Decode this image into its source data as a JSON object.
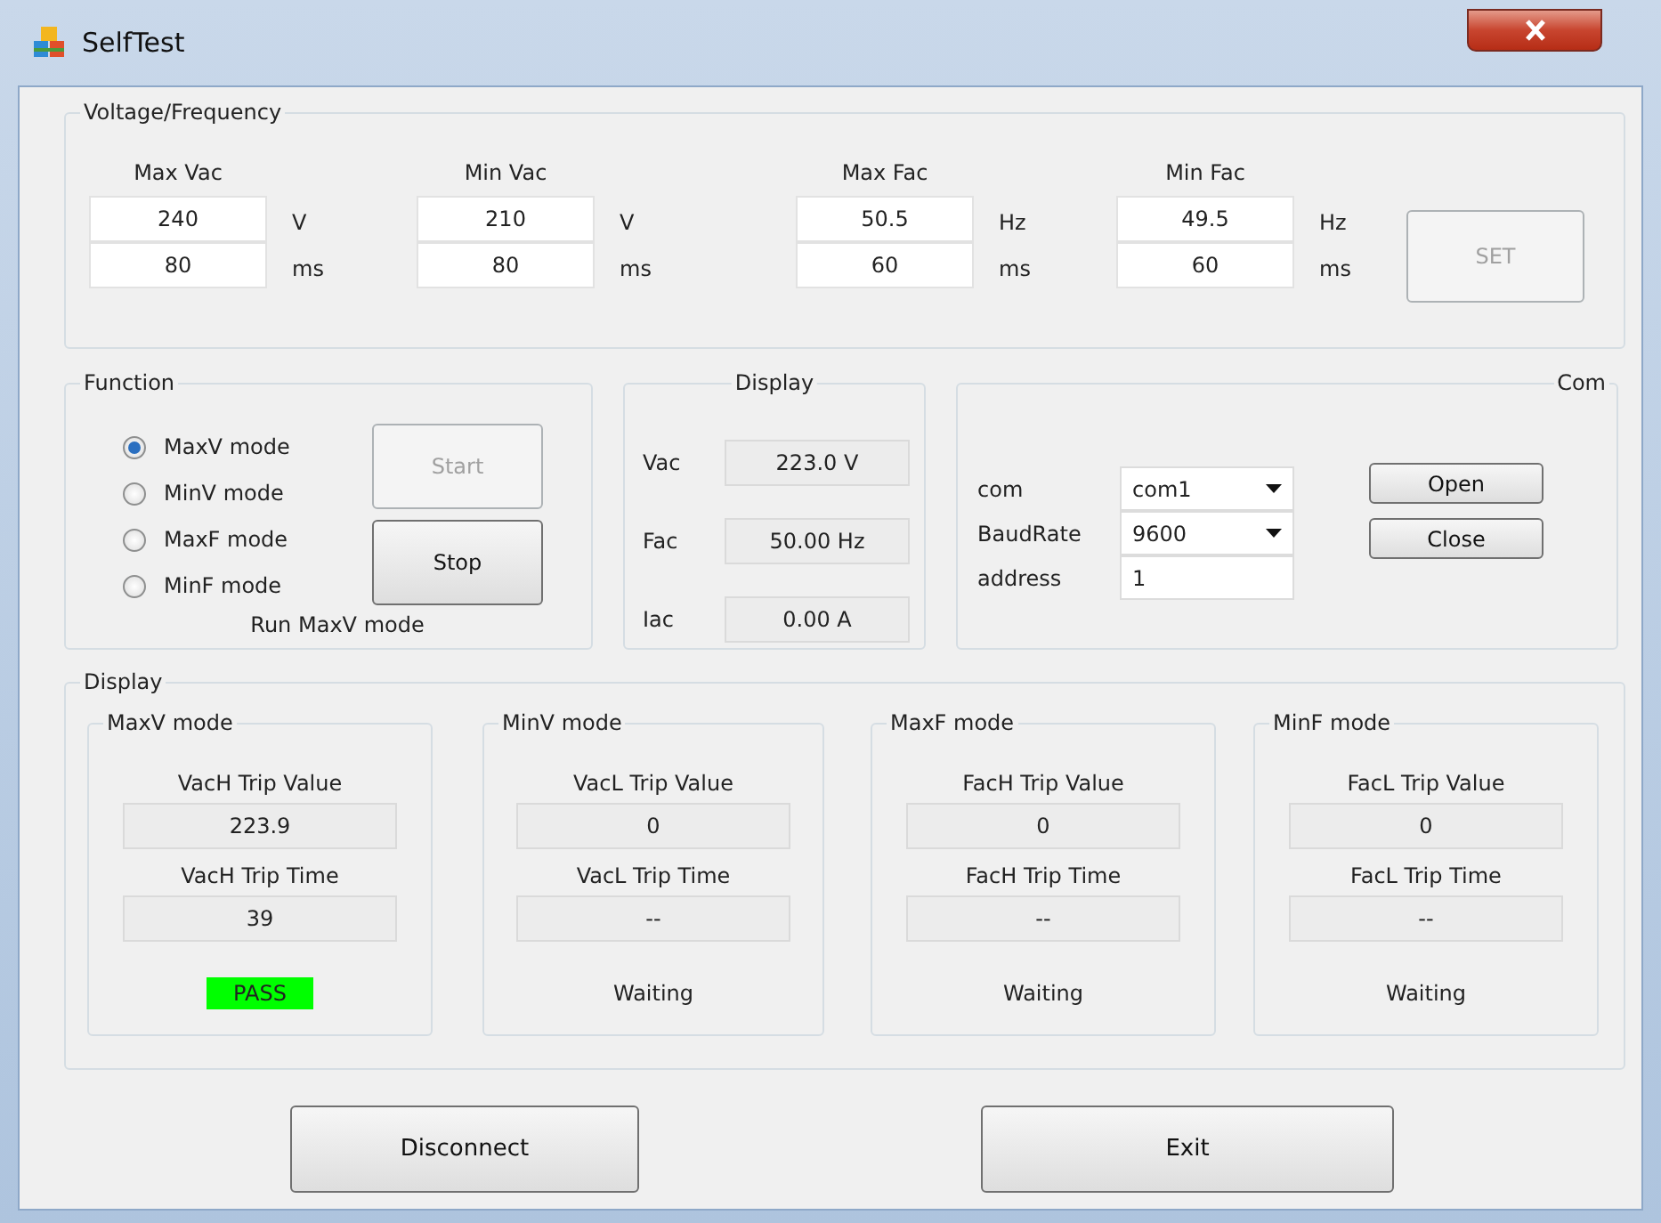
{
  "window": {
    "title": "SelfTest"
  },
  "voltage_frequency": {
    "title": "Voltage/Frequency",
    "columns": [
      {
        "label": "Max Vac",
        "value": "240",
        "value_unit": "V",
        "time": "80",
        "time_unit": "ms"
      },
      {
        "label": "Min Vac",
        "value": "210",
        "value_unit": "V",
        "time": "80",
        "time_unit": "ms"
      },
      {
        "label": "Max Fac",
        "value": "50.5",
        "value_unit": "Hz",
        "time": "60",
        "time_unit": "ms"
      },
      {
        "label": "Min Fac",
        "value": "49.5",
        "value_unit": "Hz",
        "time": "60",
        "time_unit": "ms"
      }
    ],
    "set_button": {
      "label": "SET",
      "disabled": true
    }
  },
  "function": {
    "title": "Function",
    "modes": [
      {
        "label": "MaxV mode",
        "selected": true
      },
      {
        "label": "MinV  mode",
        "selected": false
      },
      {
        "label": "MaxF mode",
        "selected": false
      },
      {
        "label": "MinF  mode",
        "selected": false
      }
    ],
    "start_button": {
      "label": "Start",
      "disabled": true
    },
    "stop_button": {
      "label": "Stop",
      "disabled": false
    },
    "status": "Run MaxV mode"
  },
  "display": {
    "title": "Display",
    "readings": [
      {
        "label": "Vac",
        "value": "223.0 V"
      },
      {
        "label": "Fac",
        "value": "50.00 Hz"
      },
      {
        "label": "Iac",
        "value": "0.00 A"
      }
    ]
  },
  "com": {
    "title": "Com",
    "fields": [
      {
        "label": "com",
        "kind": "dropdown",
        "value": "com1"
      },
      {
        "label": "BaudRate",
        "kind": "dropdown",
        "value": "9600"
      },
      {
        "label": "address",
        "kind": "text",
        "value": "1"
      }
    ],
    "buttons": [
      "Open",
      "Close"
    ]
  },
  "results": {
    "title": "Display",
    "panels": [
      {
        "title": "MaxV mode",
        "value_label": "VacH Trip Value",
        "value": "223.9",
        "time_label": "VacH Trip Time",
        "time": "39",
        "status": "PASS",
        "kind": "pass"
      },
      {
        "title": "MinV mode",
        "value_label": "VacL Trip Value",
        "value": "0",
        "time_label": "VacL Trip Time",
        "time": "--",
        "status": "Waiting",
        "kind": "waiting"
      },
      {
        "title": "MaxF mode",
        "value_label": "FacH Trip Value",
        "value": "0",
        "time_label": "FacH Trip Time",
        "time": "--",
        "status": "Waiting",
        "kind": "waiting"
      },
      {
        "title": "MinF mode",
        "value_label": "FacL Trip Value",
        "value": "0",
        "time_label": "FacL Trip Time",
        "time": "--",
        "status": "Waiting",
        "kind": "waiting"
      }
    ]
  },
  "buttons": [
    "Disconnect",
    "Exit"
  ]
}
